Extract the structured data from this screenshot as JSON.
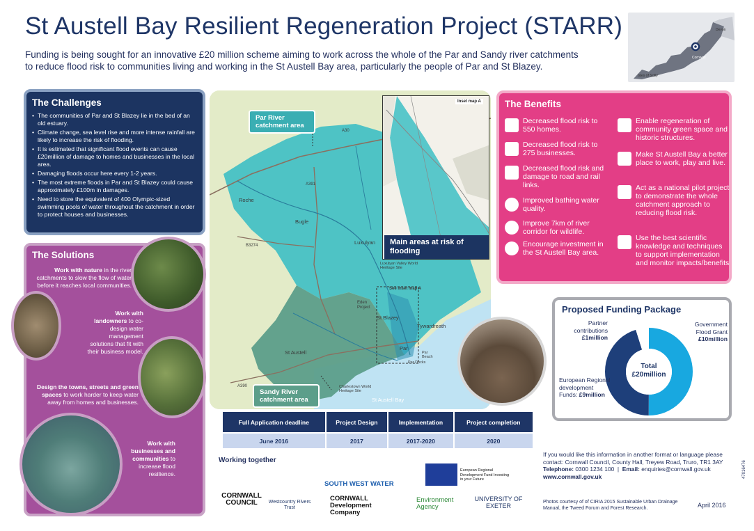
{
  "header": {
    "title": "St Austell Bay Resilient Regeneration Project (STARR)",
    "intro_line1": "Funding is being sought for an innovative £20 million scheme aiming to work across the whole of the Par and Sandy river catchments",
    "intro_line2": "to reduce flood risk to communities living and working in the St Austell Bay area, particularly the people of Par and St Blazey."
  },
  "locator_map": {
    "labels": [
      "Devon",
      "Cornwall",
      "Isles of Scilly"
    ]
  },
  "challenges": {
    "title": "The Challenges",
    "items": [
      "The communities of Par and St Blazey lie in the bed of an old estuary.",
      "Climate change, sea level rise and more intense rainfall are likely to increase the risk of flooding.",
      "It is estimated that significant flood events can cause £20million of damage to homes and businesses in the local area.",
      "Damaging floods occur here every 1-2 years.",
      "The most extreme floods in Par and St Blazey could cause approximately £100m in damages.",
      "Need to store the equivalent of 400 Olympic-sized swimming pools of water throughout the catchment in order to protect houses and businesses."
    ]
  },
  "solutions": {
    "title": "The Solutions",
    "items": [
      {
        "bold": "Work with nature",
        "text": " in the river catchments to slow the flow of water before it reaches local communities."
      },
      {
        "bold": "Work with landowners",
        "text": " to co-design water management solutions that fit with their business model."
      },
      {
        "bold": "Design the towns, streets and green spaces",
        "text": " to work harder to keep water away from homes and businesses."
      },
      {
        "bold": "Work with businesses and communities",
        "text": " to increase flood resilience."
      }
    ]
  },
  "map": {
    "callout_par": "Par River catchment area",
    "callout_sandy": "Sandy River catchment area",
    "callout_main": "Main areas at risk of flooding",
    "inset_label": "Inset map A",
    "see_inset": "See inset map A",
    "places": {
      "roche": "Roche",
      "bugle": "Bugle",
      "luxulyan": "Luxulyan",
      "luxulyan_valley": "Luxulyan Valley World Heritage Site",
      "eden": "Eden Project",
      "st_blazey": "St Blazey",
      "tywardreath": "Tywardreath",
      "par": "Par",
      "par_beach": "Par Beach",
      "par_docks": "Par Docks",
      "st_austell": "St Austell",
      "charlestown": "Charlestown World Heritage Site",
      "st_austell_bay": "St Austell Bay"
    },
    "roads": [
      "A30",
      "A391",
      "B3274",
      "A390"
    ]
  },
  "benefits": {
    "title": "The Benefits",
    "left": [
      "Decreased flood risk to 550 homes.",
      "Decreased flood risk to 275 businesses.",
      "Decreased flood risk and damage to road and rail links.",
      "Improved bathing water quality.",
      "Improve 7km of river corridor for wildlife.",
      "Encourage investment in the St Austell Bay area."
    ],
    "right": [
      "Enable regeneration of community green space and historic structures.",
      "Make St Austell Bay a better place to work, play and live.",
      "Act as a national pilot project to demonstrate the whole catchment approach to reducing flood risk.",
      "Use the best scientific knowledge and techniques to support implementation and monitor impacts/benefits"
    ]
  },
  "funding": {
    "title": "Proposed Funding Package",
    "center_label": "Total",
    "center_value": "£20million",
    "slices": [
      {
        "label": "Government Flood Grant",
        "value_text": "£10million",
        "amount": 10,
        "color": "#18a8e0"
      },
      {
        "label": "European Regional development Funds:",
        "value_text": "£9million",
        "amount": 9,
        "color": "#1e3f7a"
      },
      {
        "label": "Partner contributions",
        "value_text": "£1million",
        "amount": 1,
        "color": "#ffffff"
      }
    ]
  },
  "timeline": {
    "headers": [
      "Full Application deadline",
      "Project Design",
      "Implementation",
      "Project completion"
    ],
    "values": [
      "June 2016",
      "2017",
      "2017-2020",
      "2020"
    ]
  },
  "partners": {
    "heading": "Working together",
    "logos": [
      "CORNWALL COUNCIL",
      "Westcountry Rivers Trust",
      "SOUTH WEST WATER",
      "European Regional Development Fund Investing in your Future",
      "CORNWALL Development Company",
      "Environment Agency",
      "UNIVERSITY OF EXETER"
    ]
  },
  "contact": {
    "line1": "If you would like this information in another format or language please",
    "line2": "contact: Cornwall Council, County Hall, Treyew Road, Truro, TR1 3AY",
    "phone_label": "Telephone:",
    "phone": "0300 1234 100",
    "email_label": "Email:",
    "email": "enquiries@cornwall.gov.uk",
    "web": "www.cornwall.gov.uk"
  },
  "footer": {
    "photos": "Photos courtesy of of CIRIA 2015 Sustainable Urban Drainage Manual, the Tweed Forum and Forest Research.",
    "date": "April 2016",
    "code": "47016476"
  },
  "colors": {
    "navy": "#1c3461",
    "purple": "#a4509c",
    "pink": "#e33e86",
    "teal": "#3dbfc4",
    "green": "#5c9e8a",
    "sea": "#bfe3f3"
  }
}
